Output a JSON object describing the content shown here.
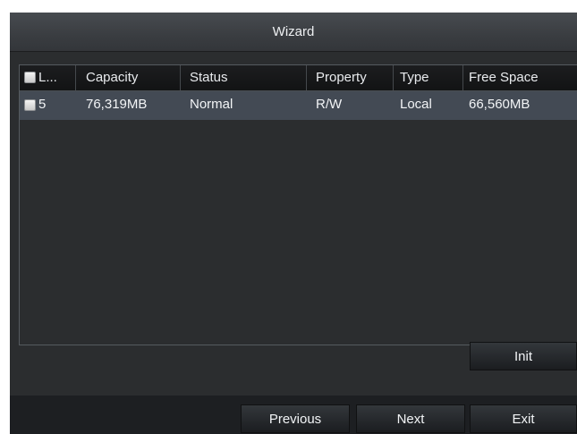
{
  "window": {
    "title": "Wizard"
  },
  "table": {
    "headers": [
      "L...",
      "Capacity",
      "Status",
      "Property",
      "Type",
      "Free Space"
    ],
    "rows": [
      {
        "label": "5",
        "capacity": "76,319MB",
        "status": "Normal",
        "property": "R/W",
        "type": "Local",
        "free_space": "66,560MB"
      }
    ]
  },
  "buttons": {
    "init": "Init",
    "previous": "Previous",
    "next": "Next",
    "exit": "Exit"
  },
  "colors": {
    "background": "#2b2d2f",
    "selected_row": "#434a54",
    "title_bar": "#3a3d41"
  }
}
